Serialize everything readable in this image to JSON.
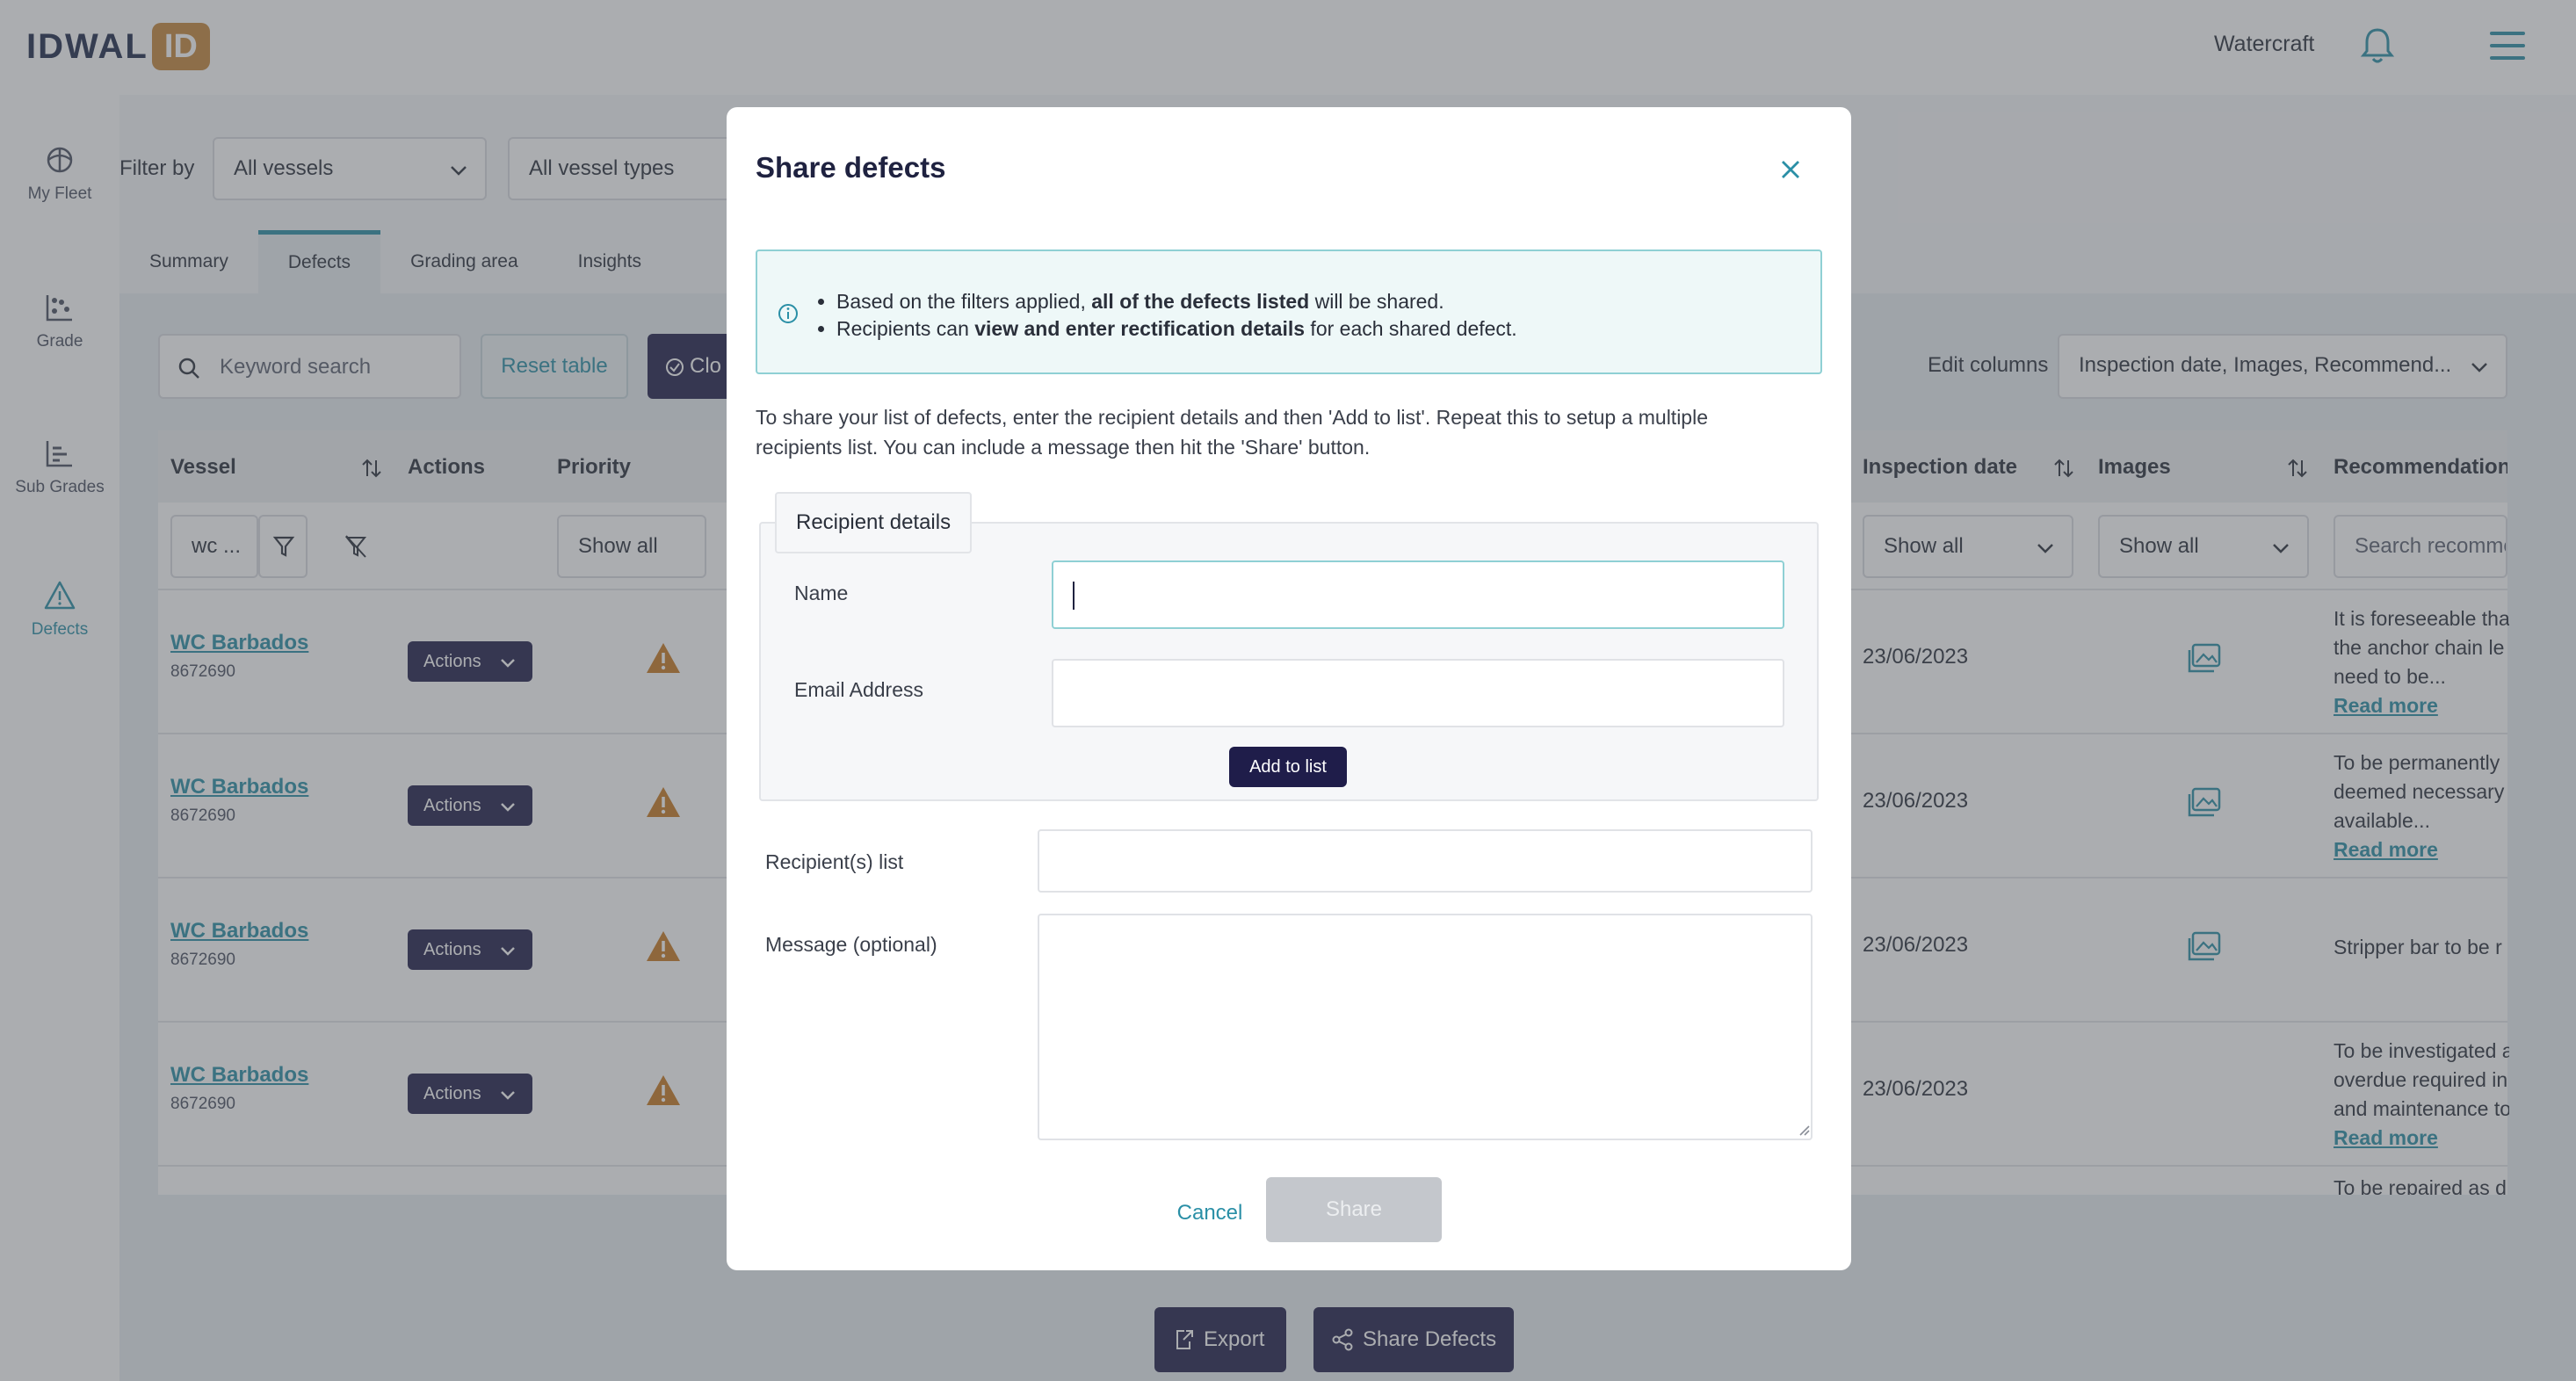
{
  "header": {
    "logo_main": "IDWAL",
    "logo_badge": "ID",
    "account": "Watercraft"
  },
  "sidebar": {
    "items": [
      {
        "label": "My Fleet",
        "icon": "fleet-icon"
      },
      {
        "label": "Grade",
        "icon": "grade-chart-icon"
      },
      {
        "label": "Sub Grades",
        "icon": "sub-grades-icon"
      },
      {
        "label": "Defects",
        "icon": "warning-triangle-icon"
      }
    ]
  },
  "filters": {
    "label": "Filter by",
    "vessels": "All vessels",
    "vessel_types": "All vessel types"
  },
  "tabs": [
    {
      "label": "Summary"
    },
    {
      "label": "Defects"
    },
    {
      "label": "Grading area"
    },
    {
      "label": "Insights"
    }
  ],
  "toolbar": {
    "keyword_placeholder": "Keyword search",
    "reset_label": "Reset table",
    "clear_label": "Clo",
    "edit_columns_label": "Edit columns",
    "edit_columns_value": "Inspection date, Images, Recommend..."
  },
  "table": {
    "headers": {
      "vessel": "Vessel",
      "actions": "Actions",
      "priority": "Priority",
      "inspection_date": "Inspection date",
      "images": "Images",
      "recommendations": "Recommendations"
    },
    "filters": {
      "vessel_value": "wc ...",
      "priority": "Show all",
      "inspection_date": "Show all",
      "images": "Show all",
      "recommendations_placeholder": "Search recommendations"
    },
    "rows": [
      {
        "vessel": "WC Barbados",
        "imo": "8672690",
        "action": "Actions",
        "date": "23/06/2023",
        "rec_lines": [
          "It is foreseeable that",
          "the anchor chain le",
          "need to be..."
        ],
        "read_more": "Read more"
      },
      {
        "vessel": "WC Barbados",
        "imo": "8672690",
        "action": "Actions",
        "date": "23/06/2023",
        "rec_lines": [
          "To be permanently",
          "deemed necessary",
          "available..."
        ],
        "read_more": "Read more"
      },
      {
        "vessel": "WC Barbados",
        "imo": "8672690",
        "action": "Actions",
        "date": "23/06/2023",
        "rec_lines": [
          "Stripper bar to be r"
        ],
        "read_more": ""
      },
      {
        "vessel": "WC Barbados",
        "imo": "8672690",
        "action": "Actions",
        "date": "23/06/2023",
        "rec_lines": [
          "To be investigated a",
          "overdue required in",
          "and maintenance to"
        ],
        "read_more": "Read more"
      }
    ],
    "partial_row_text": "To be repaired as d"
  },
  "bottom": {
    "export": "Export",
    "share_defects": "Share Defects"
  },
  "modal": {
    "title": "Share defects",
    "info": {
      "line1_pre": "Based on the filters applied, ",
      "line1_bold": "all of the defects listed",
      "line1_post": " will be shared.",
      "line2_pre": "Recipients can ",
      "line2_bold": "view and enter rectification details",
      "line2_post": " for each shared defect."
    },
    "description_line1": "To share your list of defects, enter the recipient details and then 'Add to list'. Repeat this to setup a multiple",
    "description_line2": "recipients list. You can include a message then hit the 'Share' button.",
    "recipient_legend": "Recipient details",
    "name_label": "Name",
    "name_value": "",
    "email_label": "Email Address",
    "email_value": "",
    "add_label": "Add to list",
    "recipients_label": "Recipient(s) list",
    "message_label": "Message (optional)",
    "message_value": "",
    "cancel": "Cancel",
    "share": "Share"
  }
}
